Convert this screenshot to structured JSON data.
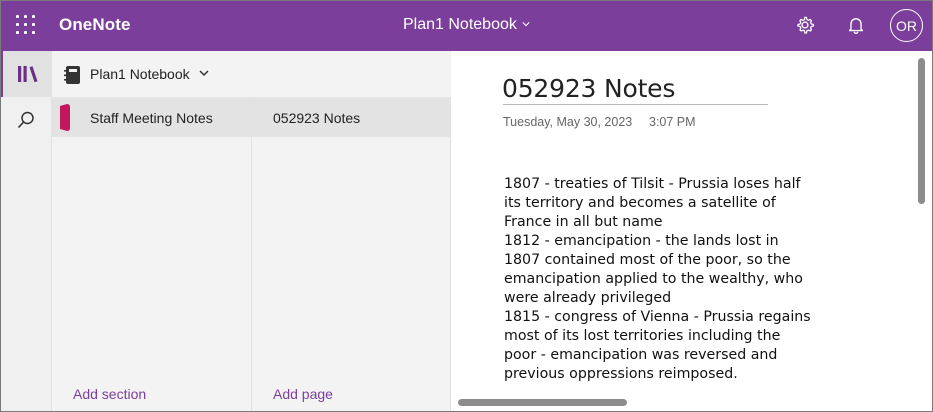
{
  "app": {
    "title": "OneNote"
  },
  "header": {
    "notebook_title": "Plan1 Notebook",
    "avatar_initials": "OR",
    "accent_color": "#7b3f9b"
  },
  "nav": {
    "notebook_name": "Plan1 Notebook",
    "sections": [
      {
        "label": "Staff Meeting Notes",
        "color": "#c2185b"
      }
    ],
    "pages": [
      {
        "label": "052923 Notes"
      }
    ],
    "add_section_label": "Add section",
    "add_page_label": "Add page"
  },
  "page": {
    "title": "052923 Notes",
    "date": "Tuesday, May 30, 2023",
    "time": "3:07 PM",
    "lines": [
      "1807 - treaties of Tilsit - Prussia loses half",
      "its territory and becomes a satellite of",
      "France in all but name",
      "1812 - emancipation - the lands lost in",
      "1807 contained most of the poor, so the",
      "emancipation applied to the wealthy, who",
      "were already privileged",
      "1815 - congress of Vienna - Prussia regains",
      "most of its lost territories including the",
      "poor - emancipation was reversed and",
      "previous oppressions reimposed."
    ]
  },
  "icons": {
    "app_launcher": "waffle-icon",
    "settings": "gear-icon",
    "notifications": "bell-icon",
    "notebooks": "notebooks-icon",
    "search": "search-icon"
  }
}
